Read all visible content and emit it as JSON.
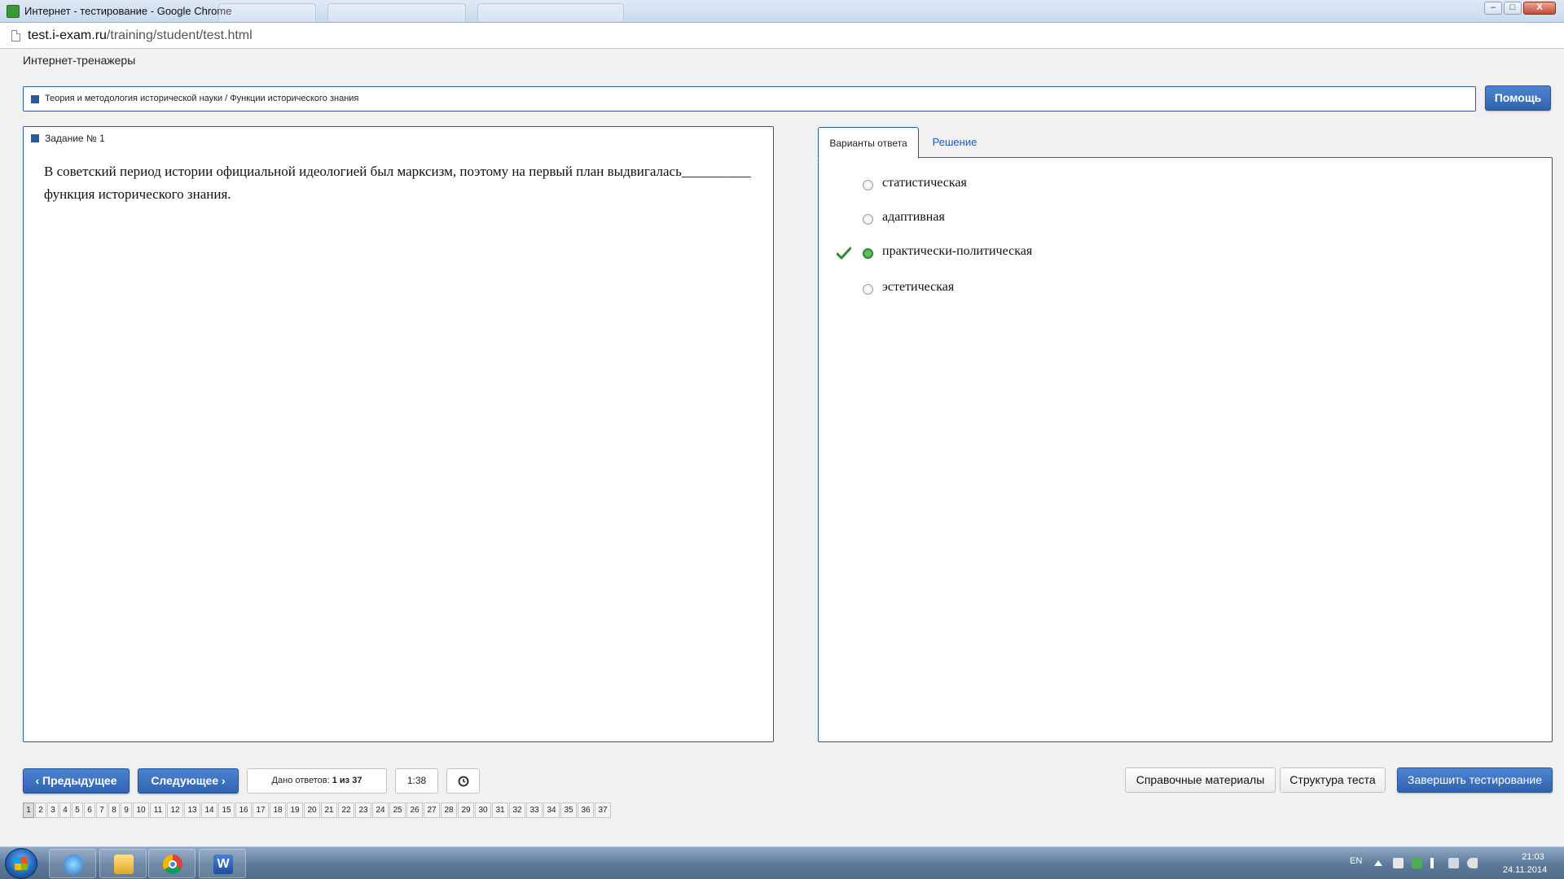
{
  "window": {
    "title": "Интернет - тестирование - Google Chrome",
    "controls": {
      "minimize": "–",
      "maximize": "□",
      "close": "X"
    }
  },
  "address_bar": {
    "host": "test.i-exam.ru",
    "path": "/training/student/test.html"
  },
  "site": {
    "title": "Интернет-тренажеры"
  },
  "breadcrumb": "Теория и методология исторической науки / Функции исторического знания",
  "help_button": "Помощь",
  "question": {
    "label": "Задание № 1",
    "text": "В советский период истории официальной идеологией был марксизм, поэтому на первый план выдвигалась__________ функция исторического знания."
  },
  "tabs": {
    "answers": "Варианты ответа",
    "solution": "Решение"
  },
  "options": [
    {
      "label": "статистическая",
      "selected": false
    },
    {
      "label": "адаптивная",
      "selected": false
    },
    {
      "label": "практически-политическая",
      "selected": true
    },
    {
      "label": "эстетическая",
      "selected": false
    }
  ],
  "toolbar": {
    "prev": "Предыдущее",
    "next": "Следующее",
    "answers_given_prefix": "Дано ответов:",
    "answers_given_value": "1 из 37",
    "timer": "1:38",
    "reference": "Справочные материалы",
    "structure": "Структура теста",
    "finish": "Завершить тестирование"
  },
  "pager": {
    "current": 1,
    "pages": [
      "1",
      "2",
      "3",
      "4",
      "5",
      "6",
      "7",
      "8",
      "9",
      "10",
      "11",
      "12",
      "13",
      "14",
      "15",
      "16",
      "17",
      "18",
      "19",
      "20",
      "21",
      "22",
      "23",
      "24",
      "25",
      "26",
      "27",
      "28",
      "29",
      "30",
      "31",
      "32",
      "33",
      "34",
      "35",
      "36",
      "37"
    ]
  },
  "taskbar": {
    "word_glyph": "W",
    "language": "EN",
    "time": "21:03",
    "date": "24.11.2014"
  },
  "colors": {
    "accent": "#2c5aa0",
    "link": "#1e5bb8",
    "correct": "#2f8a2f"
  }
}
